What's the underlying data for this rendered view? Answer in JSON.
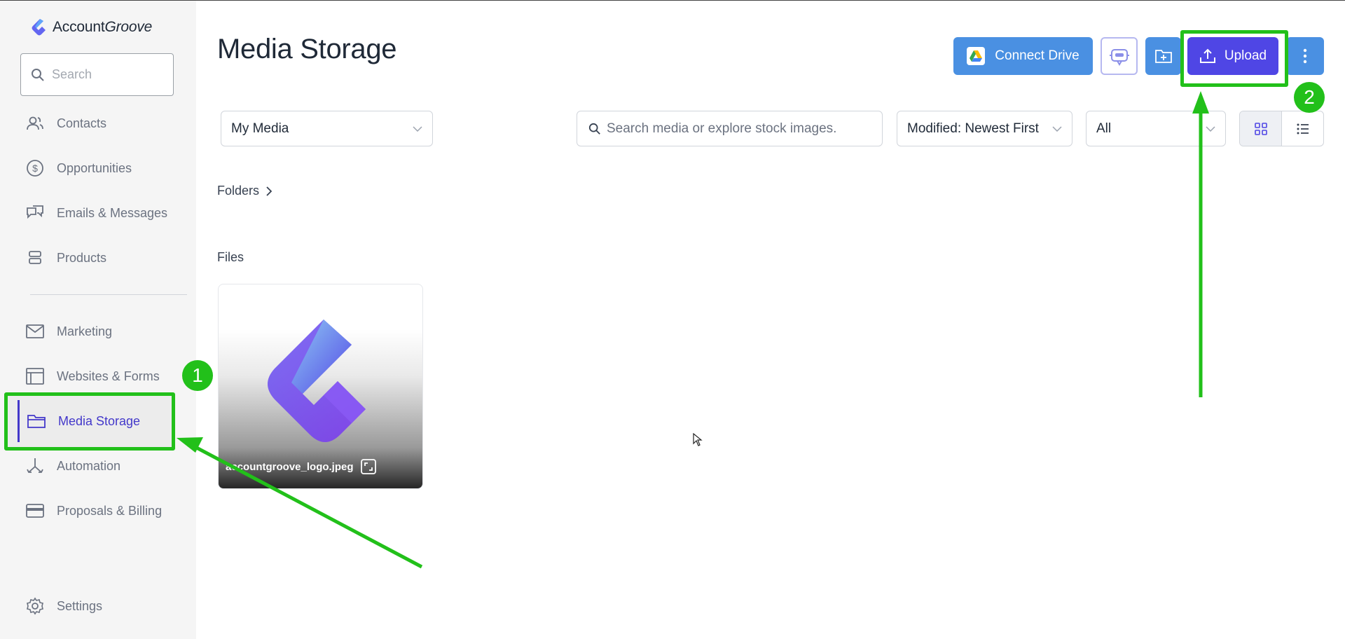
{
  "app": {
    "brand_prefix": "Account",
    "brand_suffix": "Groove"
  },
  "sidebar": {
    "search_placeholder": "Search",
    "items": [
      {
        "label": "Contacts",
        "icon": "users-icon"
      },
      {
        "label": "Opportunities",
        "icon": "dollar-icon"
      },
      {
        "label": "Emails & Messages",
        "icon": "chat-icon"
      },
      {
        "label": "Products",
        "icon": "box-icon"
      },
      {
        "label": "Marketing",
        "icon": "mail-icon"
      },
      {
        "label": "Websites & Forms",
        "icon": "browser-icon"
      },
      {
        "label": "Media Storage",
        "icon": "folder-icon",
        "active": true
      },
      {
        "label": "Automation",
        "icon": "flow-icon"
      },
      {
        "label": "Proposals & Billing",
        "icon": "card-icon"
      }
    ],
    "settings_label": "Settings"
  },
  "header": {
    "title": "Media Storage",
    "connect_drive": "Connect Drive",
    "upload": "Upload"
  },
  "filters": {
    "media_select": "My Media",
    "search_placeholder": "Search media or explore stock images.",
    "sort_select": "Modified: Newest First",
    "type_select": "All"
  },
  "sections": {
    "folders": "Folders",
    "files": "Files"
  },
  "files": [
    {
      "name": "accountgroove_logo.jpeg"
    }
  ],
  "annotations": {
    "step1": "1",
    "step2": "2",
    "color": "#22c01a"
  },
  "colors": {
    "accent": "#4f46e5",
    "button_blue": "#4a90e2",
    "sidebar_bg": "#f5f5f5"
  }
}
